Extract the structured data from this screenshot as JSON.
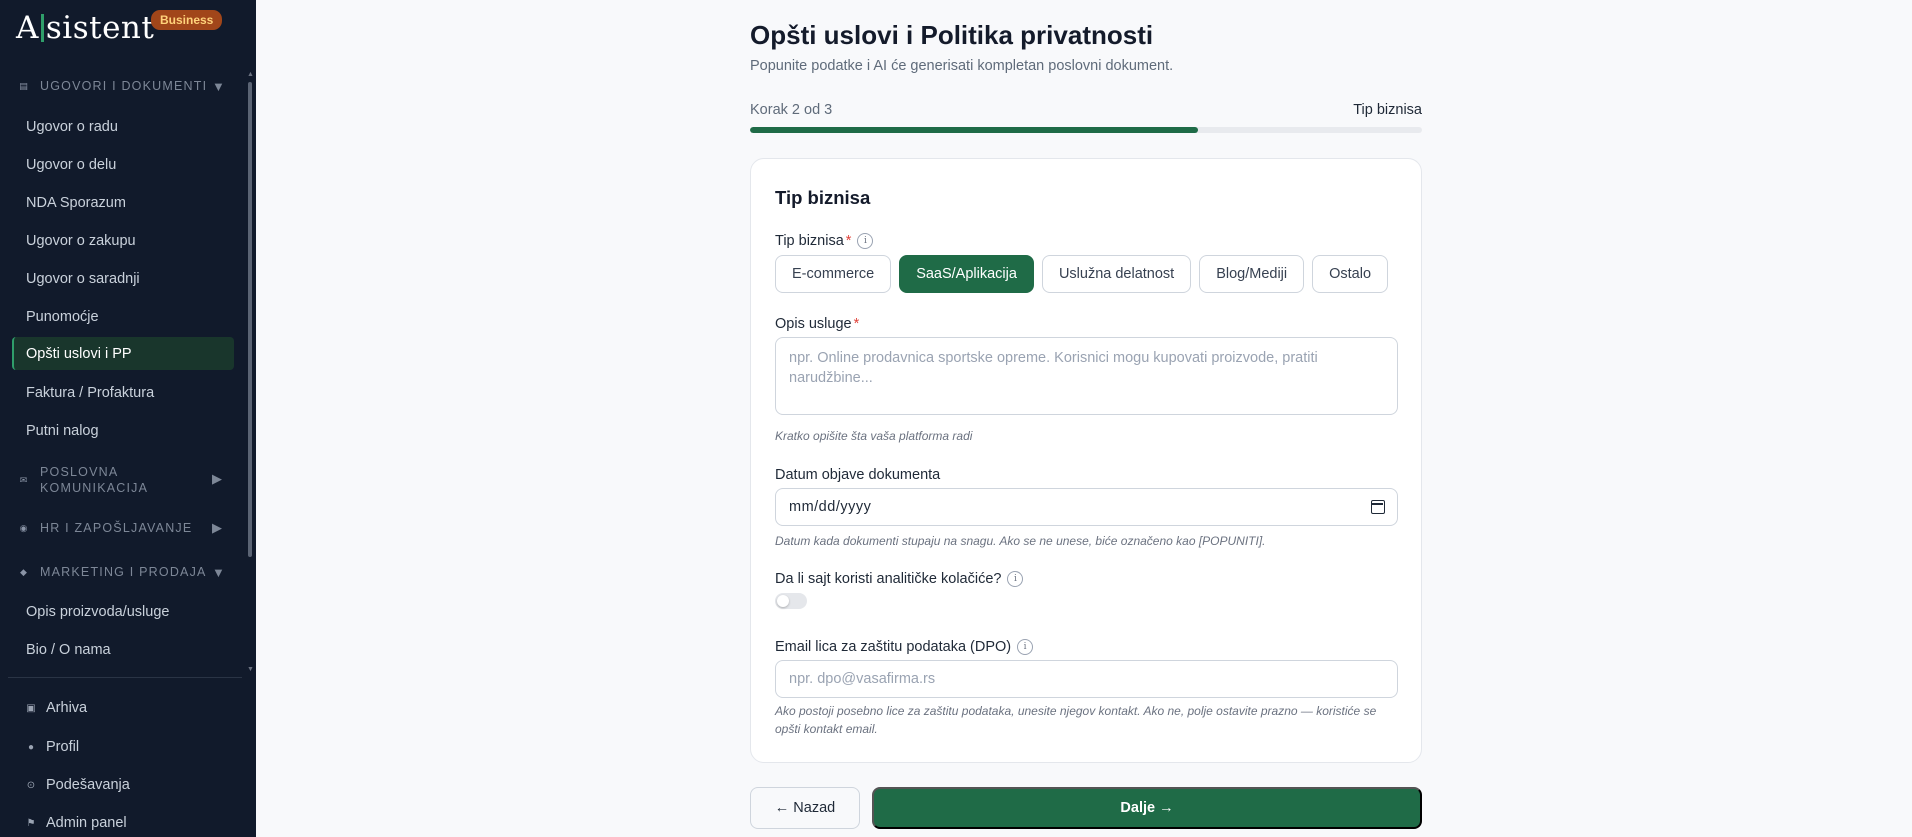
{
  "brand": {
    "logo_prefix": "A",
    "logo_suffix": "sistent",
    "badge": "Business"
  },
  "sidebar": {
    "sections": [
      {
        "label": "UGOVORI I DOKUMENTI",
        "icon": "document-icon",
        "expanded": true
      },
      {
        "label": "POSLOVNA KOMUNIKACIJA",
        "icon": "mail-icon",
        "expanded": false
      },
      {
        "label": "HR I ZAPOŠLJAVANJE",
        "icon": "people-icon",
        "expanded": false
      },
      {
        "label": "MARKETING I PRODAJA",
        "icon": "diamond-icon",
        "expanded": true
      }
    ],
    "contracts": [
      "Ugovor o radu",
      "Ugovor o delu",
      "NDA Sporazum",
      "Ugovor o zakupu",
      "Ugovor o saradnji",
      "Punomoćje",
      "Opšti uslovi i PP",
      "Faktura / Profaktura",
      "Putni nalog"
    ],
    "marketing": [
      "Opis proizvoda/usluge",
      "Bio / O nama"
    ],
    "footer": [
      {
        "label": "Arhiva",
        "icon": "archive-icon"
      },
      {
        "label": "Profil",
        "icon": "profile-icon"
      },
      {
        "label": "Podešavanja",
        "icon": "settings-icon"
      },
      {
        "label": "Admin panel",
        "icon": "flag-icon"
      }
    ],
    "active_item": "Opšti uslovi i PP"
  },
  "main": {
    "title": "Opšti uslovi i Politika privatnosti",
    "subtitle": "Popunite podatke i AI će generisati kompletan poslovni dokument.",
    "step_label": "Korak 2 od 3",
    "step_name": "Tip biznisa",
    "progress_fraction": 0.667
  },
  "card": {
    "title": "Tip biznisa",
    "business_type": {
      "label": "Tip biznisa",
      "required_mark": "*",
      "options": [
        "E-commerce",
        "SaaS/Aplikacija",
        "Uslužna delatnost",
        "Blog/Mediji",
        "Ostalo"
      ],
      "selected": "SaaS/Aplikacija"
    },
    "description": {
      "label": "Opis usluge",
      "required_mark": "*",
      "placeholder_line1": "npr. Online prodavnica sportske opreme. Korisnici mogu kupovati proizvode, pratiti",
      "placeholder_line2": "narudžbine...",
      "hint": "Kratko opišite šta vaša platforma radi"
    },
    "date": {
      "label": "Datum objave dokumenta",
      "value": "mm/dd/yyyy",
      "hint": "Datum kada dokumenti stupaju na snagu. Ako se ne unese, biće označeno kao [POPUNITI]."
    },
    "cookies": {
      "label": "Da li sajt koristi analitičke kolačiće?",
      "enabled": false
    },
    "dpo": {
      "label": "Email lica za zaštitu podataka (DPO)",
      "placeholder": "npr. dpo@vasafirma.rs",
      "hint": "Ako postoji posebno lice za zaštitu podataka, unesite njegov kontakt. Ako ne, polje ostavite prazno — koristiće se opšti kontakt email."
    }
  },
  "actions": {
    "back": "← Nazad",
    "next": "Dalje →"
  },
  "colors": {
    "sidebar_bg": "#111a2b",
    "accent": "#1f6b47",
    "badge_bg": "#a1461a",
    "required": "#e0433a"
  }
}
